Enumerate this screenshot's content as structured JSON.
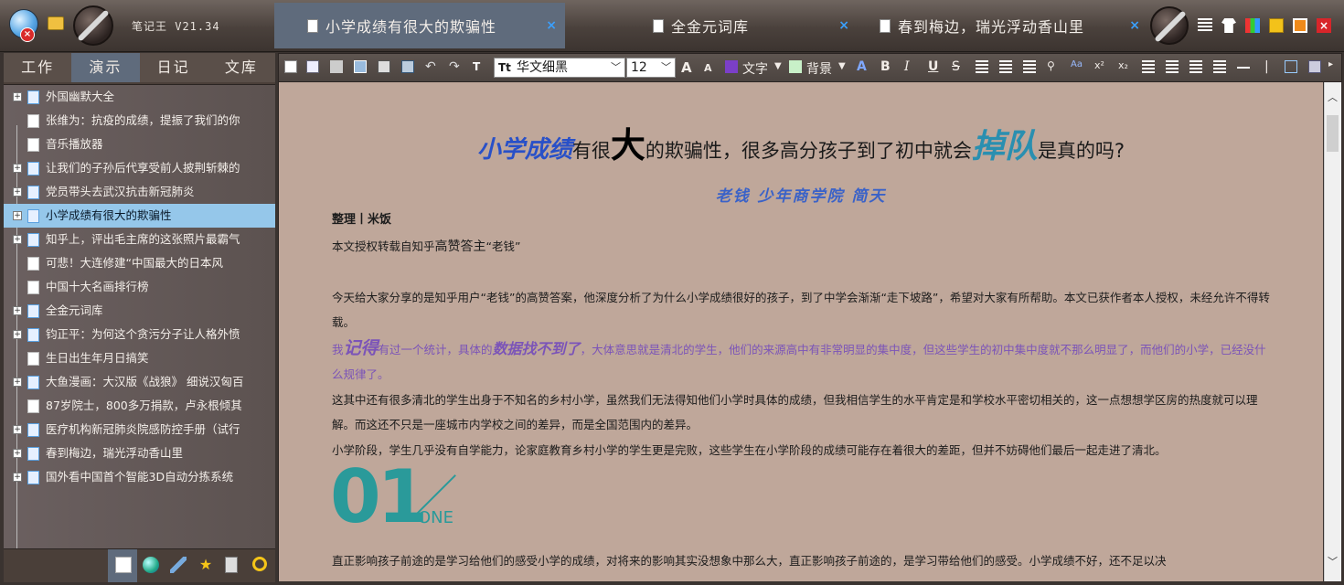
{
  "app": {
    "version": "笔记王 V21.34"
  },
  "doc_tabs": [
    {
      "title": "小学成绩有很大的欺骗性",
      "close": "×"
    },
    {
      "title": "全金元词库",
      "close": "×"
    },
    {
      "title": "春到梅边，瑞光浮动香山里",
      "close": "×"
    }
  ],
  "left_tabs": [
    "工作",
    "演示",
    "日记",
    "文库"
  ],
  "tree_items": [
    "外国幽默大全",
    "张维为：抗疫的成绩，提振了我们的你",
    "音乐播放器",
    "让我们的子孙后代享受前人披荆斩棘的",
    "党员带头去武汉抗击新冠肺炎",
    "小学成绩有很大的欺骗性",
    "知乎上，评出毛主席的这张照片最霸气",
    "可悲！大连修建“中国最大的日本风",
    "中国十大名画排行榜",
    "全金元词库",
    "钧正平：为何这个贪污分子让人格外愤",
    "生日出生年月日搞笑",
    "大鱼漫画：大汉版《战狼》 细说汉匈百",
    "87岁院士，800多万捐款，卢永根倾其",
    "医疗机构新冠肺炎院感防控手册（试行",
    "春到梅边，瑞光浮动香山里",
    "国外看中国首个智能3D自动分拣系统"
  ],
  "toolbar": {
    "font": "华文细黑",
    "size": "12",
    "text_color_label": "文字",
    "bg_color_label": "背景",
    "text_color": "#7b3fc8",
    "bg_color": "#c8f0c8"
  },
  "article": {
    "title_part1": "小学成绩",
    "title_part2": "有很",
    "title_part3": "大",
    "title_part4": "的欺骗性，很多高分孩子到了初中就会",
    "title_part5": "掉队",
    "title_part6": "是真的吗?",
    "subtitle": "老钱  少年商学院  简天",
    "byline": "整理丨米饭",
    "source_prefix": "本文授权转载自知乎",
    "source_big": "高赞答主",
    "source_suffix": "“老钱”",
    "para1": "今天给大家分享的是知乎用户“老钱”的高赞答案，他深度分析了为什么小学成绩很好的孩子，到了中学会渐渐“走下坡路”，希望对大家有所帮助。本文已获作者本人授权，未经允许不得转载。",
    "para2_a": "我",
    "para2_b": "记得",
    "para2_c": "有过一个统计，具体的",
    "para2_d": "数据找不到了",
    "para2_e": "，大体意思就是清北的学生，他们的来源高中有非常明显的集中度，但这些学生的初中集中度就不那么明显了，而他们的小学，已经没什么规律了。",
    "para3": "这其中还有很多清北的学生出身于不知名的乡村小学，虽然我们无法得知他们小学时具体的成绩，但我相信学生的水平肯定是和学校水平密切相关的，这一点想想学区房的热度就可以理解。而这还不只是一座城市内学校之间的差异，而是全国范围内的差异。",
    "para4": "小学阶段，学生几乎没有自学能力，论家庭教育乡村小学的学生更是完败，这些学生在小学阶段的成绩可能存在着很大的差距，但并不妨碍他们最后一起走进了清北。",
    "section_num": "01",
    "section_word": "ONE",
    "para5": "直正影响孩子前途的是学习给他们的感受小学的成绩，对将来的影响其实没想象中那么大，直正影响孩子前途的，是学习带给他们的感受。小学成绩不好，还不足以决"
  }
}
